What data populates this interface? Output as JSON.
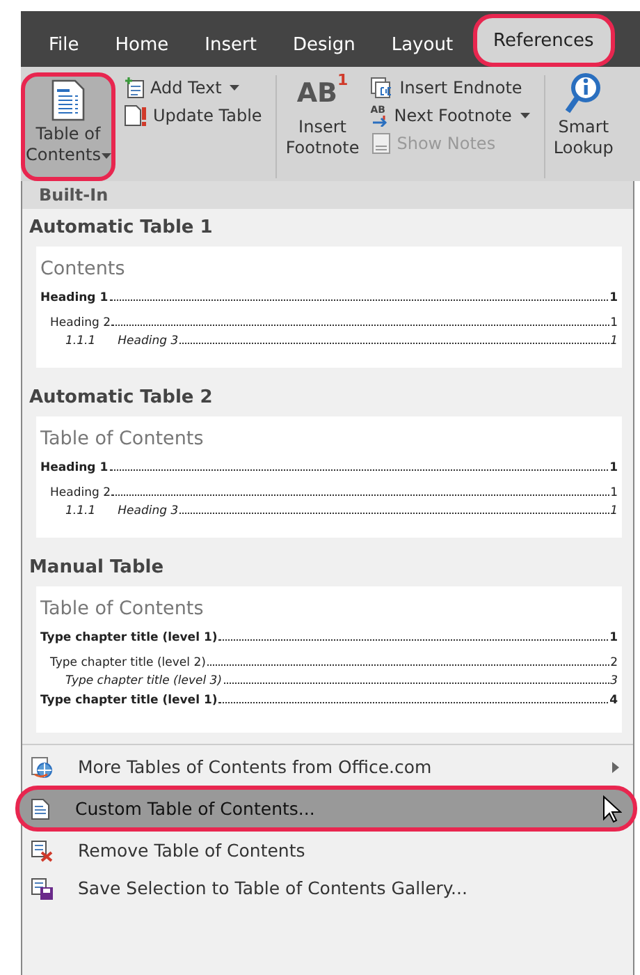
{
  "tabs": [
    {
      "label": "File",
      "selected": false,
      "highlighted": false
    },
    {
      "label": "Home",
      "selected": false,
      "highlighted": false
    },
    {
      "label": "Insert",
      "selected": false,
      "highlighted": false
    },
    {
      "label": "Design",
      "selected": false,
      "highlighted": false
    },
    {
      "label": "Layout",
      "selected": false,
      "highlighted": false
    },
    {
      "label": "References",
      "selected": true,
      "highlighted": true
    }
  ],
  "ribbon": {
    "toc_button": {
      "lines": [
        "Table of",
        "Contents"
      ],
      "pressed": true,
      "highlighted": true
    },
    "toc_small": [
      {
        "label": "Add Text",
        "dropdown": true,
        "disabled": false
      },
      {
        "label": "Update Table",
        "dropdown": false,
        "disabled": false
      }
    ],
    "footnote_button": {
      "icon_text": "AB",
      "icon_superscript": "1",
      "lines": [
        "Insert",
        "Footnote"
      ]
    },
    "footnote_small": [
      {
        "label": "Insert Endnote",
        "dropdown": false,
        "disabled": false
      },
      {
        "icon_text": "AB",
        "label": "Next Footnote",
        "dropdown": true,
        "disabled": false
      },
      {
        "label": "Show Notes",
        "dropdown": false,
        "disabled": true
      }
    ],
    "lookup_button": {
      "lines": [
        "Smart",
        "Lookup"
      ]
    }
  },
  "menu": {
    "header": "Built-In",
    "gallery": [
      {
        "title": "Automatic Table 1",
        "preview_title": "Contents",
        "entries": [
          {
            "text": "Heading 1",
            "page": "1",
            "children": [
              {
                "text": "Heading 2",
                "page": "1",
                "children": [
                  {
                    "number": "1.1.1",
                    "text": "Heading 3",
                    "page": "1"
                  }
                ]
              }
            ]
          }
        ]
      },
      {
        "title": "Automatic Table 2",
        "preview_title": "Table of Contents",
        "entries": [
          {
            "text": "Heading 1",
            "page": "1",
            "children": [
              {
                "text": "Heading 2",
                "page": "1",
                "children": [
                  {
                    "number": "1.1.1",
                    "text": "Heading 3",
                    "page": "1"
                  }
                ]
              }
            ]
          }
        ]
      },
      {
        "title": "Manual Table",
        "preview_title": "Table of Contents",
        "entries": [
          {
            "text": "Type chapter title (level 1)",
            "page": "1",
            "children": [
              {
                "text": "Type chapter title (level 2)",
                "page": "2",
                "children": [
                  {
                    "text": "Type chapter title (level 3)",
                    "page": "3"
                  }
                ]
              }
            ]
          },
          {
            "text": "Type chapter title (level 1)",
            "page": "4"
          }
        ]
      }
    ],
    "items": [
      {
        "label": "More Tables of Contents from Office.com",
        "submenu": true,
        "selected": false,
        "highlighted": false
      },
      {
        "label": "Custom Table of Contents...",
        "submenu": false,
        "selected": true,
        "highlighted": true
      },
      {
        "label": "Remove Table of Contents",
        "submenu": false,
        "selected": false,
        "highlighted": false
      },
      {
        "label": "Save Selection to Table of Contents Gallery...",
        "submenu": false,
        "selected": false,
        "highlighted": false
      }
    ]
  }
}
